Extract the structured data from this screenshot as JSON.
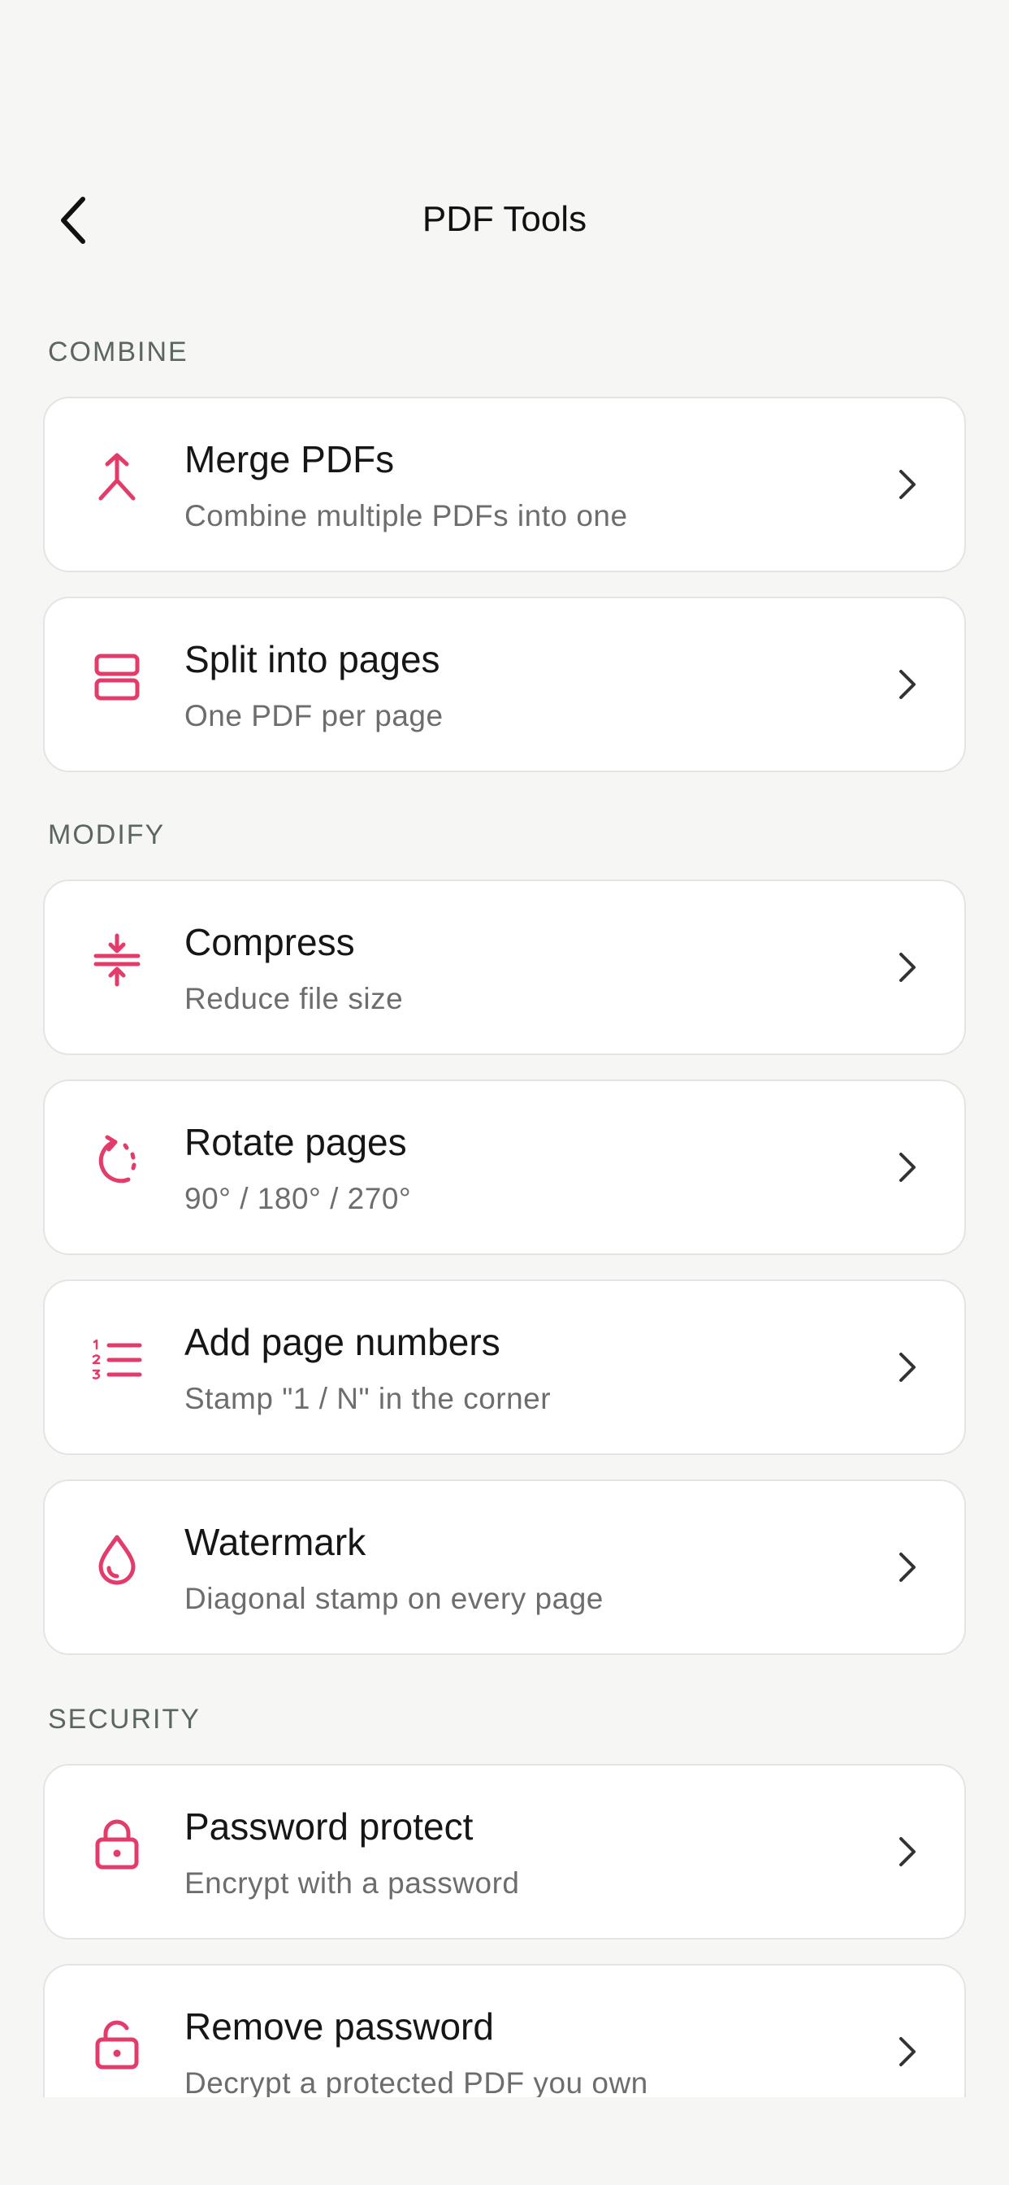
{
  "header": {
    "title": "PDF Tools"
  },
  "sections": [
    {
      "label": "COMBINE",
      "items": [
        {
          "name": "Merge PDFs",
          "desc": "Combine multiple PDFs into one",
          "icon": "merge-icon"
        },
        {
          "name": "Split into pages",
          "desc": "One PDF per page",
          "icon": "split-icon"
        }
      ]
    },
    {
      "label": "MODIFY",
      "items": [
        {
          "name": "Compress",
          "desc": "Reduce file size",
          "icon": "compress-icon"
        },
        {
          "name": "Rotate pages",
          "desc": "90° / 180° / 270°",
          "icon": "rotate-icon"
        },
        {
          "name": "Add page numbers",
          "desc": "Stamp \"1 / N\" in the corner",
          "icon": "numbered-list-icon"
        },
        {
          "name": "Watermark",
          "desc": "Diagonal stamp on every page",
          "icon": "droplet-icon"
        }
      ]
    },
    {
      "label": "SECURITY",
      "items": [
        {
          "name": "Password protect",
          "desc": "Encrypt with a password",
          "icon": "lock-icon"
        },
        {
          "name": "Remove password",
          "desc": "Decrypt a protected PDF you own",
          "icon": "unlock-icon"
        }
      ]
    }
  ],
  "colors": {
    "accent": "#e33b6a",
    "background": "#f6f6f5",
    "card": "#ffffff",
    "section_label": "#5b6660"
  }
}
